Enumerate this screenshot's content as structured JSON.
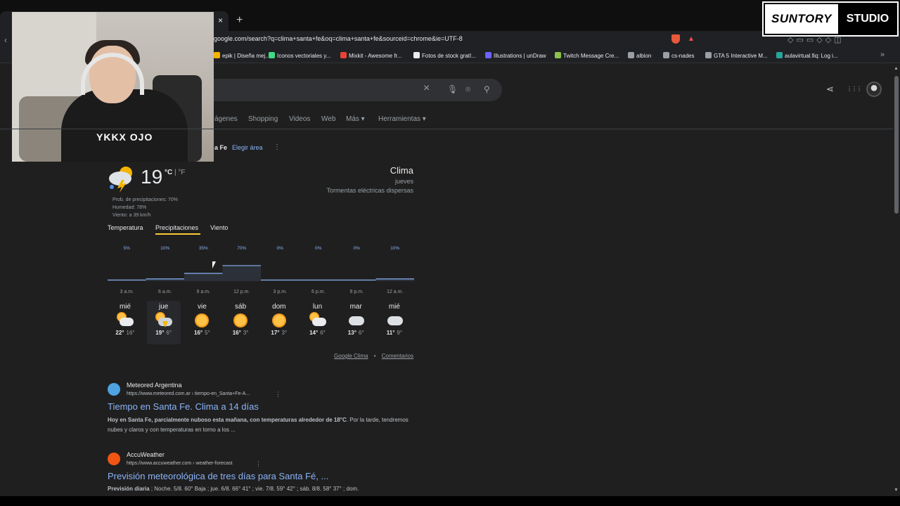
{
  "browser": {
    "tab_close": "×",
    "new_tab": "+",
    "url": "google.com/search?q=clima+santa+fe&oq=clima+santa+fe&sourceid=chrome&ie=UTF-8",
    "more_bookmarks": "»",
    "bookmarks": [
      {
        "label": "epik | Diseña mej...",
        "color": "#f4b400"
      },
      {
        "label": "Iconos vectoriales y...",
        "color": "#3ddc84"
      },
      {
        "label": "Mixkit - Awesome fr...",
        "color": "#ea4335"
      },
      {
        "label": "Fotos de stock gratI...",
        "color": "#eeeeee"
      },
      {
        "label": "Illustrations | unDraw",
        "color": "#6c63ff"
      },
      {
        "label": "Twitch Message Cre...",
        "color": "#8bc34a"
      },
      {
        "label": "albion",
        "color": "#9aa0a6"
      },
      {
        "label": "cs-nades",
        "color": "#9aa0a6"
      },
      {
        "label": "GTA 5 Interactive M...",
        "color": "#9aa0a6"
      },
      {
        "label": "aulavirtual.fiq: Log i...",
        "color": "#26a69a"
      }
    ]
  },
  "overlay": {
    "brand_left": "SUNTORY",
    "brand_right": "STUDIO",
    "hoodie_text": "YKKX OJO"
  },
  "search": {
    "clear_icon": "×",
    "mic_icon": "🎙",
    "lens_icon": "⌾",
    "search_icon": "⚲",
    "share_icon": "⋖",
    "apps_icon": "⋮⋮⋮"
  },
  "nav_tabs": [
    "ágenes",
    "Shopping",
    "Videos",
    "Web",
    "Más ▾",
    "Herramientas ▾"
  ],
  "location": {
    "name": "a Fe",
    "change_link": "Elegir área",
    "more": "⋮"
  },
  "weather": {
    "temperature": "19",
    "unit_c": "°C",
    "unit_sep": " | ",
    "unit_f": "°F",
    "precip": "Prob. de precipitaciones: 70%",
    "humidity": "Humedad: 78%",
    "wind": "Viento: a 39 km/h",
    "title": "Clima",
    "day": "jueves",
    "condition": "Tormentas eléctricas dispersas",
    "tabs": [
      "Temperatura",
      "Precipitaciones",
      "Viento"
    ],
    "active_tab": "Precipitaciones",
    "colors": {
      "accent_line": "#fcc934",
      "bar": "#8ab4f8",
      "link": "#8ab4f8"
    }
  },
  "chart_data": {
    "type": "bar",
    "categories": [
      "3 a.m.",
      "6 a.m.",
      "9 a.m.",
      "12 p.m.",
      "3 p.m.",
      "6 p.m.",
      "9 p.m.",
      "12 a.m."
    ],
    "values": [
      5,
      10,
      35,
      70,
      0,
      0,
      0,
      10
    ],
    "value_labels": [
      "5%",
      "10%",
      "35%",
      "70%",
      "0%",
      "0%",
      "0%",
      "10%"
    ],
    "ylim": [
      0,
      100
    ],
    "title": "",
    "xlabel": "",
    "ylabel": ""
  },
  "forecast": [
    {
      "day": "mié",
      "hi": "22°",
      "lo": "16°",
      "icon": "partly-sunny-icon"
    },
    {
      "day": "jue",
      "hi": "19°",
      "lo": "6°",
      "icon": "thunderstorm-icon",
      "selected": true
    },
    {
      "day": "vie",
      "hi": "16°",
      "lo": "5°",
      "icon": "sunny-icon"
    },
    {
      "day": "sáb",
      "hi": "16°",
      "lo": "3°",
      "icon": "sunny-icon"
    },
    {
      "day": "dom",
      "hi": "17°",
      "lo": "3°",
      "icon": "sunny-icon"
    },
    {
      "day": "lun",
      "hi": "14°",
      "lo": "6°",
      "icon": "partly-sunny-icon"
    },
    {
      "day": "mar",
      "hi": "13°",
      "lo": "6°",
      "icon": "cloudy-icon"
    },
    {
      "day": "mié",
      "hi": "11°",
      "lo": "9°",
      "icon": "cloudy-icon"
    }
  ],
  "source_links": {
    "google": "Google Clima",
    "sep": "•",
    "feedback": "Comentarios"
  },
  "results": [
    {
      "site": "Meteored Argentina",
      "url": "https://www.meteored.com.ar › tiempo-en_Santa+Fe-A...",
      "title": "Tiempo en Santa Fe. Clima a 14 días",
      "snippet_bold": "Hoy en Santa Fe, parcialmente nuboso esta mañana, con temperaturas alrededor de 18°C",
      "snippet": ". Por la tarde, tendremos nubes y claros y con temperaturas en torno a los ...",
      "more": "⋮",
      "icon_color": "#4fa3e0"
    },
    {
      "site": "AccuWeather",
      "url": "https://www.accuweather.com › weather-forecast",
      "title": "Previsión meteorológica de tres días para Santa Fé, ...",
      "snippet_bold": "Previsión diaria",
      "snippet": " ; Noche. 5/8. 60° Baja ; jue. 6/8. 66° 41° ; vie. 7/8. 59° 42° ; sáb. 8/8. 58° 37° ; dom.",
      "more": "⋮",
      "icon_color": "#f05514"
    }
  ]
}
